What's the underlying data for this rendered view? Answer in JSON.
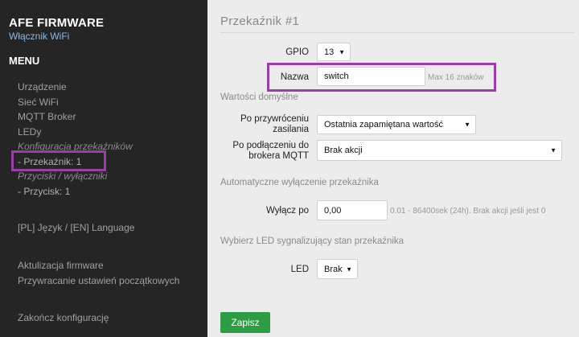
{
  "brand": {
    "title": "AFE FIRMWARE",
    "subtitle": "Włącznik WiFi"
  },
  "menu": {
    "heading": "MENU",
    "items": [
      {
        "label": "Urządzenie"
      },
      {
        "label": "Sieć WiFi"
      },
      {
        "label": "MQTT Broker"
      },
      {
        "label": "LEDy"
      },
      {
        "label": "Konfiguracja przekaźników"
      },
      {
        "label": "- Przekaźnik: 1"
      },
      {
        "label": "Przyciski / wyłączniki"
      },
      {
        "label": "- Przycisk: 1"
      },
      {
        "label": "[PL] Język / [EN] Language"
      },
      {
        "label": "Aktulizacja firmware"
      },
      {
        "label": "Przywracanie ustawień początkowych"
      },
      {
        "label": "Zakończ konfigurację"
      }
    ]
  },
  "form": {
    "title": "Przekaźnik #1",
    "gpio": {
      "label": "GPIO",
      "value": "13"
    },
    "name": {
      "label": "Nazwa",
      "value": "switch",
      "hint": "Max 16 znaków"
    },
    "defaults_heading": "Wartości domyślne",
    "power_restore": {
      "label_line1": "Po przywróceniu",
      "label_line2": "zasilania",
      "value": "Ostatnia zapamiętana wartość"
    },
    "mqtt_connect": {
      "label_line1": "Po podłączeniu do",
      "label_line2": "brokera MQTT",
      "value": "Brak akcji"
    },
    "auto_off_heading": "Automatyczne wyłączenie przekaźnika",
    "off_after": {
      "label": "Wyłącz po",
      "value": "0,00",
      "hint": "0.01 - 86400sek (24h). Brak akcji jeśli jest 0"
    },
    "led_heading": "Wybierz LED sygnalizujący stan przekaźnika",
    "led": {
      "label": "LED",
      "value": "Brak"
    },
    "save_label": "Zapisz"
  },
  "icons": {
    "dropdown": "▼"
  },
  "colors": {
    "sidebar_bg": "#252525",
    "highlight": "#9a3fa6",
    "save_button": "#2e9c45"
  }
}
